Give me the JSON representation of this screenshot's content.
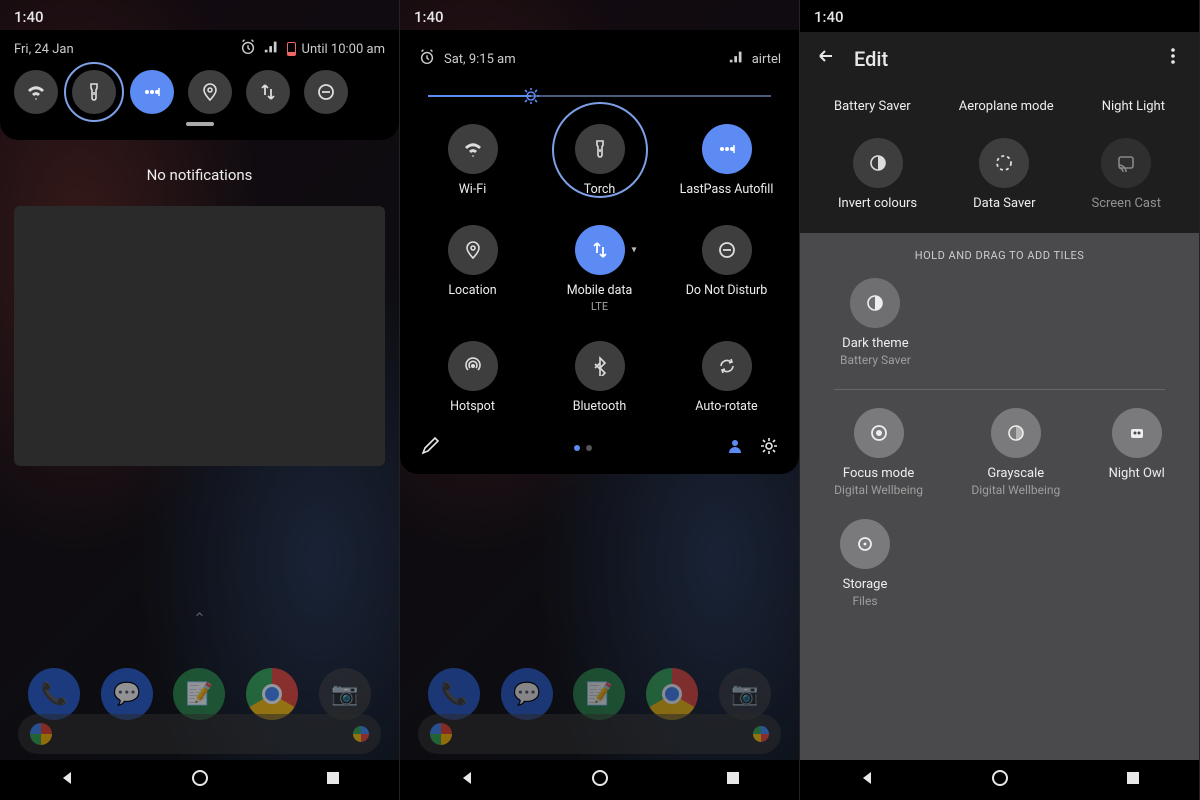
{
  "panel1": {
    "clock": "1:40",
    "date": "Fri, 24 Jan",
    "alarm_text": "Until 10:00 am",
    "no_notifications": "No notifications",
    "tiles": [
      {
        "name": "wifi",
        "icon": "wifi",
        "on": false
      },
      {
        "name": "torch",
        "icon": "torch",
        "on": false,
        "highlight": true
      },
      {
        "name": "lastpass",
        "icon": "dots",
        "on": true
      },
      {
        "name": "location",
        "icon": "pin",
        "on": false
      },
      {
        "name": "mobiledata",
        "icon": "data",
        "on": false
      },
      {
        "name": "dnd",
        "icon": "dnd",
        "on": false
      }
    ]
  },
  "panel2": {
    "clock": "1:40",
    "date": "Sat, 9:15 am",
    "carrier": "airtel",
    "brightness_pct": 30,
    "tiles": [
      {
        "name": "wifi",
        "label": "Wi-Fi",
        "icon": "wifi",
        "on": false
      },
      {
        "name": "torch",
        "label": "Torch",
        "icon": "torch",
        "on": false,
        "highlight": true
      },
      {
        "name": "lastpass",
        "label": "LastPass Autofill",
        "icon": "dots",
        "on": true
      },
      {
        "name": "location",
        "label": "Location",
        "icon": "pin",
        "on": false
      },
      {
        "name": "mobiledata",
        "label": "Mobile data",
        "sub": "LTE",
        "icon": "data",
        "on": true,
        "caret": true
      },
      {
        "name": "dnd",
        "label": "Do Not Disturb",
        "icon": "dnd",
        "on": false
      },
      {
        "name": "hotspot",
        "label": "Hotspot",
        "icon": "hotspot",
        "on": false
      },
      {
        "name": "bluetooth",
        "label": "Bluetooth",
        "icon": "bt",
        "on": false
      },
      {
        "name": "autorotate",
        "label": "Auto-rotate",
        "icon": "rotate",
        "on": false
      }
    ]
  },
  "panel3": {
    "clock": "1:40",
    "title": "Edit",
    "active_row1": [
      {
        "label": "Battery Saver"
      },
      {
        "label": "Aeroplane mode"
      },
      {
        "label": "Night Light"
      }
    ],
    "active_row2": [
      {
        "label": "Invert colours",
        "icon": "invert"
      },
      {
        "label": "Data Saver",
        "icon": "datasaver"
      },
      {
        "label": "Screen Cast",
        "icon": "cast",
        "dim": true
      }
    ],
    "drag_hint": "HOLD AND DRAG TO ADD TILES",
    "inactive_top": [
      {
        "label": "Dark theme",
        "sub": "Battery Saver",
        "icon": "invert"
      }
    ],
    "inactive_mid": [
      {
        "label": "Focus mode",
        "sub": "Digital Wellbeing",
        "icon": "focus"
      },
      {
        "label": "Grayscale",
        "sub": "Digital Wellbeing",
        "icon": "gray"
      },
      {
        "label": "Night Owl",
        "sub": "",
        "icon": "owl"
      }
    ],
    "inactive_bot": [
      {
        "label": "Storage",
        "sub": "Files",
        "icon": "dot"
      }
    ]
  }
}
